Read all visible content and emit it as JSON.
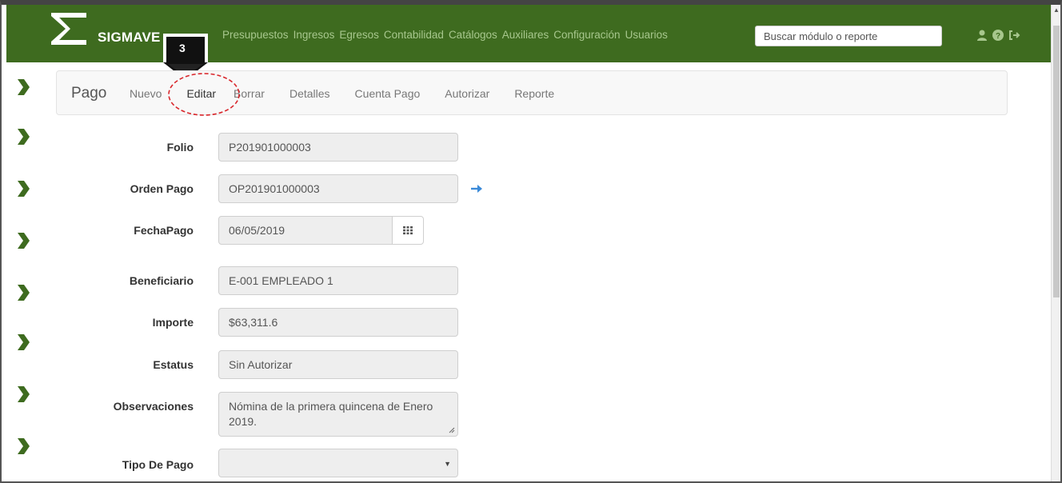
{
  "brand": {
    "name": "SIGMAVE",
    "logo_icon": "sigma-logo-icon"
  },
  "nav": {
    "links": [
      "Presupuestos",
      "Ingresos",
      "Egresos",
      "Contabilidad",
      "Catálogos",
      "Auxiliares",
      "Configuración",
      "Usuarios"
    ],
    "search_placeholder": "Buscar módulo o reporte",
    "icons": [
      "user-icon",
      "help-icon",
      "logout-icon"
    ]
  },
  "step_marker": {
    "number": "3"
  },
  "subnav": {
    "title": "Pago",
    "items": [
      "Nuevo",
      "Editar",
      "Borrar",
      "Detalles",
      "Cuenta Pago",
      "Autorizar",
      "Reporte"
    ]
  },
  "form": {
    "folio": {
      "label": "Folio",
      "value": "P201901000003"
    },
    "orden_pago": {
      "label": "Orden Pago",
      "value": "OP201901000003"
    },
    "fecha_pago": {
      "label": "FechaPago",
      "value": "06/05/2019"
    },
    "beneficiario": {
      "label": "Beneficiario",
      "value": "E-001 EMPLEADO 1"
    },
    "importe": {
      "label": "Importe",
      "value": "$63,311.6"
    },
    "estatus": {
      "label": "Estatus",
      "value": "Sin Autorizar"
    },
    "observaciones": {
      "label": "Observaciones",
      "value": "Nómina de la primera quincena de Enero 2019."
    },
    "tipo_pago": {
      "label": "Tipo De Pago",
      "value": ""
    }
  },
  "colors": {
    "navbar": "#3e6b1f",
    "nav_link": "#a7c78d",
    "chevron": "#3e6b1f",
    "highlight_ring": "#d9262b",
    "arrow_link": "#3b8ad8"
  }
}
